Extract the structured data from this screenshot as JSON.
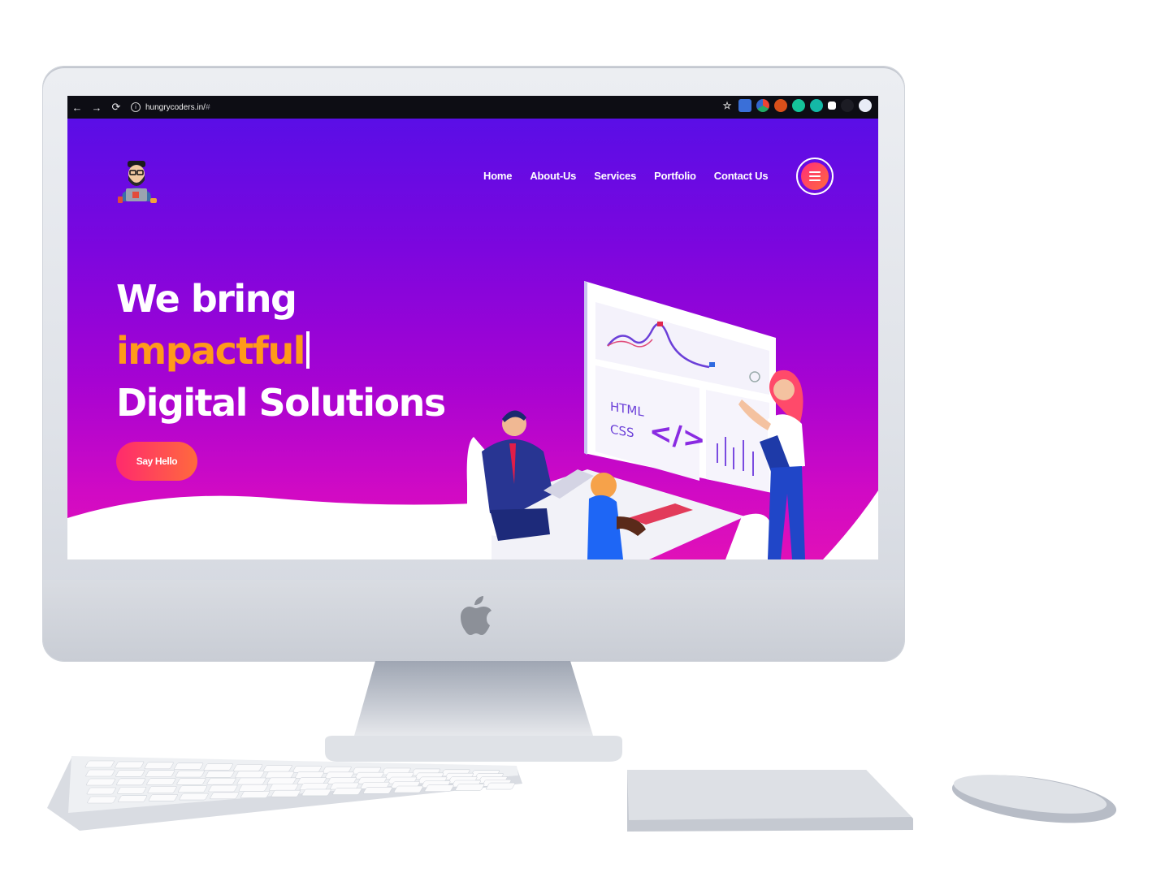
{
  "browser": {
    "back_icon": "←",
    "forward_icon": "→",
    "reload_icon": "⟳",
    "info_icon": "i",
    "url_host": "hungrycoders.in/",
    "url_path": "#"
  },
  "nav": {
    "items": [
      {
        "label": "Home"
      },
      {
        "label": "About-Us"
      },
      {
        "label": "Services"
      },
      {
        "label": "Portfolio"
      },
      {
        "label": "Contact Us"
      }
    ]
  },
  "hero": {
    "line1": "We bring",
    "line2": "impactful",
    "line3": "Digital Solutions",
    "cta_label": "Say Hello"
  },
  "illustration": {
    "html_label": "HTML",
    "css_label": "CSS",
    "code_glyph": "</>"
  },
  "colors": {
    "gradient_top": "#5a0ee6",
    "gradient_bottom": "#e010b8",
    "accent_orange": "#ff9a1a",
    "button_pink": "#ff2a6d"
  }
}
